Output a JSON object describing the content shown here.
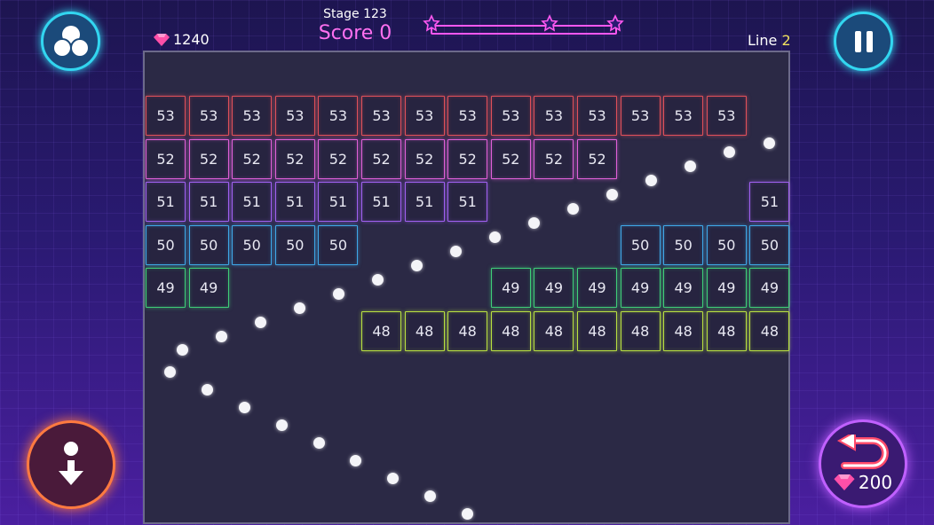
{
  "hud": {
    "gems": "1240",
    "stage": "Stage 123",
    "score": "Score 0",
    "line_label": "Line",
    "line_value": "2",
    "undo_cost": "200"
  },
  "colors": {
    "row53": "#e0505a",
    "row52": "#e060d8",
    "row51": "#a060f0",
    "row50": "#3fa8e8",
    "row49": "#3fcf78",
    "row48": "#b8e040",
    "stars": "#ff58f0",
    "pause_ring": "#32d6f0",
    "drop_ring": "#ff7a40",
    "undo_ring": "#c060ff"
  },
  "bricks": [
    {
      "row": 0,
      "col": 0,
      "value": "53"
    },
    {
      "row": 0,
      "col": 1,
      "value": "53"
    },
    {
      "row": 0,
      "col": 2,
      "value": "53"
    },
    {
      "row": 0,
      "col": 3,
      "value": "53"
    },
    {
      "row": 0,
      "col": 4,
      "value": "53"
    },
    {
      "row": 0,
      "col": 5,
      "value": "53"
    },
    {
      "row": 0,
      "col": 6,
      "value": "53"
    },
    {
      "row": 0,
      "col": 7,
      "value": "53"
    },
    {
      "row": 0,
      "col": 8,
      "value": "53"
    },
    {
      "row": 0,
      "col": 9,
      "value": "53"
    },
    {
      "row": 0,
      "col": 10,
      "value": "53"
    },
    {
      "row": 0,
      "col": 11,
      "value": "53"
    },
    {
      "row": 0,
      "col": 12,
      "value": "53"
    },
    {
      "row": 0,
      "col": 13,
      "value": "53"
    },
    {
      "row": 1,
      "col": 0,
      "value": "52"
    },
    {
      "row": 1,
      "col": 1,
      "value": "52"
    },
    {
      "row": 1,
      "col": 2,
      "value": "52"
    },
    {
      "row": 1,
      "col": 3,
      "value": "52"
    },
    {
      "row": 1,
      "col": 4,
      "value": "52"
    },
    {
      "row": 1,
      "col": 5,
      "value": "52"
    },
    {
      "row": 1,
      "col": 6,
      "value": "52"
    },
    {
      "row": 1,
      "col": 7,
      "value": "52"
    },
    {
      "row": 1,
      "col": 8,
      "value": "52"
    },
    {
      "row": 1,
      "col": 9,
      "value": "52"
    },
    {
      "row": 1,
      "col": 10,
      "value": "52"
    },
    {
      "row": 2,
      "col": 0,
      "value": "51"
    },
    {
      "row": 2,
      "col": 1,
      "value": "51"
    },
    {
      "row": 2,
      "col": 2,
      "value": "51"
    },
    {
      "row": 2,
      "col": 3,
      "value": "51"
    },
    {
      "row": 2,
      "col": 4,
      "value": "51"
    },
    {
      "row": 2,
      "col": 5,
      "value": "51"
    },
    {
      "row": 2,
      "col": 6,
      "value": "51"
    },
    {
      "row": 2,
      "col": 7,
      "value": "51"
    },
    {
      "row": 2,
      "col": 14,
      "value": "51"
    },
    {
      "row": 3,
      "col": 0,
      "value": "50"
    },
    {
      "row": 3,
      "col": 1,
      "value": "50"
    },
    {
      "row": 3,
      "col": 2,
      "value": "50"
    },
    {
      "row": 3,
      "col": 3,
      "value": "50"
    },
    {
      "row": 3,
      "col": 4,
      "value": "50"
    },
    {
      "row": 3,
      "col": 11,
      "value": "50"
    },
    {
      "row": 3,
      "col": 12,
      "value": "50"
    },
    {
      "row": 3,
      "col": 13,
      "value": "50"
    },
    {
      "row": 3,
      "col": 14,
      "value": "50"
    },
    {
      "row": 4,
      "col": 0,
      "value": "49"
    },
    {
      "row": 4,
      "col": 1,
      "value": "49"
    },
    {
      "row": 4,
      "col": 8,
      "value": "49"
    },
    {
      "row": 4,
      "col": 9,
      "value": "49"
    },
    {
      "row": 4,
      "col": 10,
      "value": "49"
    },
    {
      "row": 4,
      "col": 11,
      "value": "49"
    },
    {
      "row": 4,
      "col": 12,
      "value": "49"
    },
    {
      "row": 4,
      "col": 13,
      "value": "49"
    },
    {
      "row": 4,
      "col": 14,
      "value": "49"
    },
    {
      "row": 5,
      "col": 5,
      "value": "48"
    },
    {
      "row": 5,
      "col": 6,
      "value": "48"
    },
    {
      "row": 5,
      "col": 7,
      "value": "48"
    },
    {
      "row": 5,
      "col": 8,
      "value": "48"
    },
    {
      "row": 5,
      "col": 9,
      "value": "48"
    },
    {
      "row": 5,
      "col": 10,
      "value": "48"
    },
    {
      "row": 5,
      "col": 11,
      "value": "48"
    },
    {
      "row": 5,
      "col": 12,
      "value": "48"
    },
    {
      "row": 5,
      "col": 13,
      "value": "48"
    },
    {
      "row": 5,
      "col": 14,
      "value": "48"
    }
  ]
}
